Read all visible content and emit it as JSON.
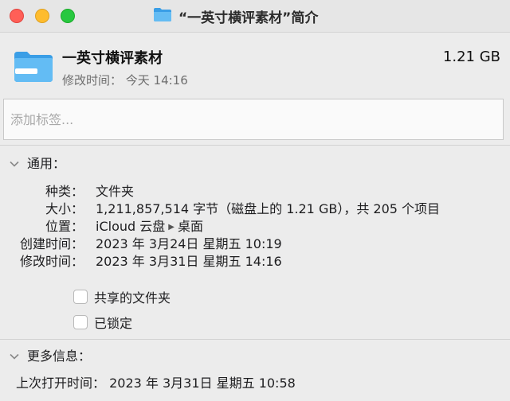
{
  "window": {
    "title": "“一英寸横评素材”简介",
    "controls": {
      "close": "close",
      "minimize": "minimize",
      "maximize": "maximize"
    }
  },
  "header": {
    "name": "一英寸横评素材",
    "size": "1.21 GB",
    "modified": "修改时间：  今天 14:16",
    "icon": "folder-icon"
  },
  "tags": {
    "placeholder": "添加标签...",
    "value": ""
  },
  "general": {
    "title": "通用：",
    "rows": [
      {
        "label": "种类：",
        "value": "文件夹"
      },
      {
        "label": "大小：",
        "value": "1,211,857,514 字节（磁盘上的 1.21 GB），共 205 个项目"
      },
      {
        "label": "位置：",
        "value_part1": "iCloud 云盘",
        "value_part2": "桌面",
        "separator_icon": "triangle-right-icon"
      },
      {
        "label": "创建时间：",
        "value": "2023 年 3月24日 星期五 10:19"
      },
      {
        "label": "修改时间：",
        "value": "2023 年 3月31日 星期五 14:16"
      }
    ],
    "checkboxes": [
      {
        "label": "共享的文件夹",
        "checked": false
      },
      {
        "label": "已锁定",
        "checked": false
      }
    ]
  },
  "more_info": {
    "title": "更多信息：",
    "last_opened": "上次打开时间：  2023 年 3月31日 星期五 10:58"
  },
  "colors": {
    "folder_light": "#5fb8f2",
    "folder_dark": "#3a9ee6",
    "close": "#ff5f57",
    "minimize": "#febc2e",
    "maximize": "#28c840"
  }
}
